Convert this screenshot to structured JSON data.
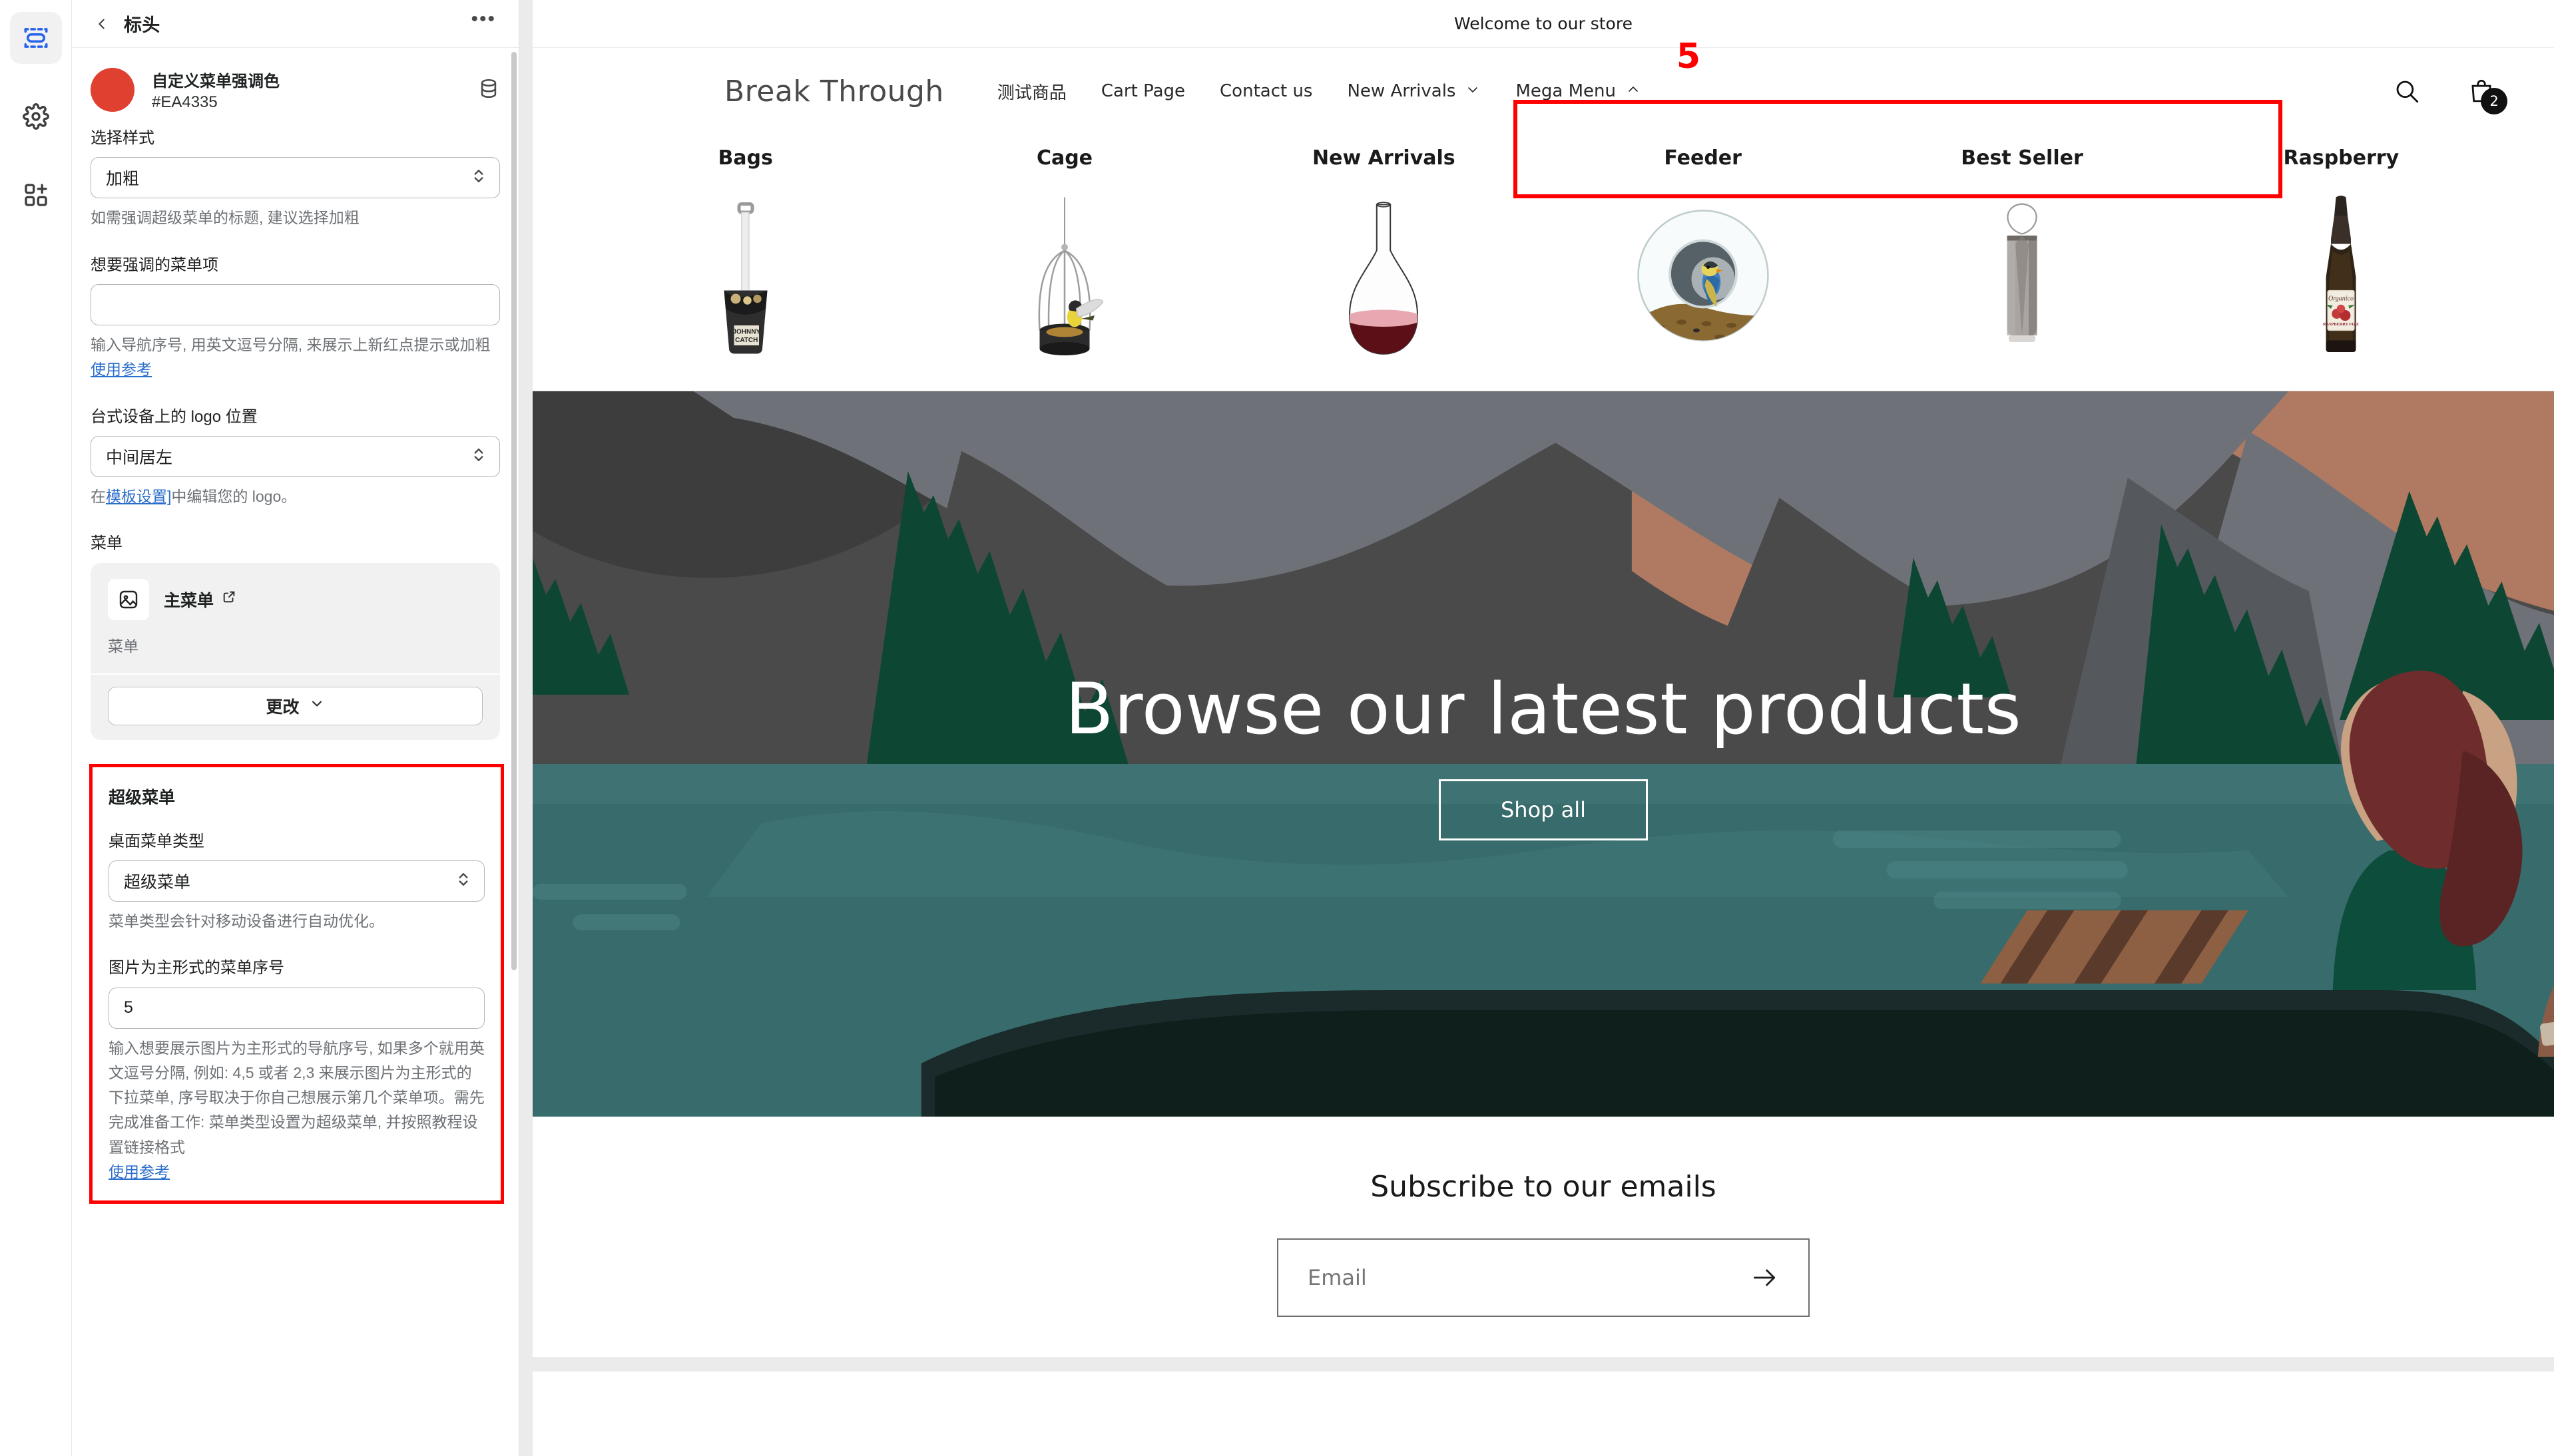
{
  "rail": {
    "items": [
      {
        "icon": "sections-icon",
        "name": "sections",
        "active": true
      },
      {
        "icon": "gear-icon",
        "name": "settings",
        "active": false
      },
      {
        "icon": "apps-add-icon",
        "name": "apps",
        "active": false
      }
    ]
  },
  "sidebar": {
    "header": {
      "back_label": "‹",
      "title": "标头",
      "more_label": "•••"
    },
    "color_setting": {
      "name": "自定义菜单强调色",
      "hex": "#EA4335",
      "swatch_color": "#E0402F",
      "db_icon": "database-icon"
    },
    "style_field": {
      "label": "选择样式",
      "value": "加粗",
      "help": "如需强调超级菜单的标题, 建议选择加粗"
    },
    "highlight_items_field": {
      "label": "想要强调的菜单项",
      "value": "",
      "placeholder": "",
      "help_before": "输入导航序号, 用英文逗号分隔, 来展示上新红点提示或加粗",
      "help_link": "使用参考"
    },
    "logo_position_field": {
      "label": "台式设备上的 logo 位置",
      "value": "中间居左",
      "help_before": "在",
      "help_link": "模板设置]",
      "help_after": "中编辑您的 logo。"
    },
    "menu_field": {
      "label": "菜单",
      "card_title": "主菜单",
      "card_external_icon": "external-link-icon",
      "card_subtitle": "菜单",
      "change_button": "更改"
    },
    "mega_menu": {
      "section_title": "超级菜单",
      "type_field": {
        "label": "桌面菜单类型",
        "value": "超级菜单",
        "help": "菜单类型会针对移动设备进行自动优化。"
      },
      "index_field": {
        "label": "图片为主形式的菜单序号",
        "value": "5",
        "help_before": "输入想要展示图片为主形式的导航序号, 如果多个就用英文逗号分隔, 例如: 4,5 或者 2,3 来展示图片为主形式的下拉菜单, 序号取决于你自己想展示第几个菜单项。需先完成准备工作: 菜单类型设置为超级菜单, 并按照教程设置链接格式",
        "help_link": "使用参考"
      },
      "highlight_color": "#FF0000"
    }
  },
  "preview": {
    "announcement": "Welcome to our store",
    "logo": "Break Through",
    "nav": [
      {
        "label": "测试商品",
        "underlined": false,
        "caret": ""
      },
      {
        "label": "Cart Page",
        "underlined": false,
        "caret": ""
      },
      {
        "label": "Contact us",
        "underlined": false,
        "caret": ""
      },
      {
        "label": "New Arrivals",
        "underlined": true,
        "caret": "chevron-down-icon"
      },
      {
        "label": "Mega Menu",
        "underlined": true,
        "caret": "chevron-up-icon"
      }
    ],
    "nav_annotation": "5",
    "header_icons": {
      "search": "search-icon",
      "cart": "cart-icon",
      "cart_count": "2"
    },
    "mega_menu_columns": [
      {
        "title": "Bags",
        "image": "bottle-opener-product"
      },
      {
        "title": "Cage",
        "image": "birdcage-product"
      },
      {
        "title": "New Arrivals",
        "image": "decanter-product"
      },
      {
        "title": "Feeder",
        "image": "bird-feeder-product"
      },
      {
        "title": "Best Seller",
        "image": "smoke-vase-product"
      },
      {
        "title": "Raspberry",
        "image": "raspberry-bottle-product"
      }
    ],
    "hero": {
      "title": "Browse our latest products",
      "button": "Shop all"
    },
    "newsletter": {
      "title": "Subscribe to our emails",
      "placeholder": "Email",
      "value": "",
      "submit_icon": "arrow-right-icon"
    }
  }
}
